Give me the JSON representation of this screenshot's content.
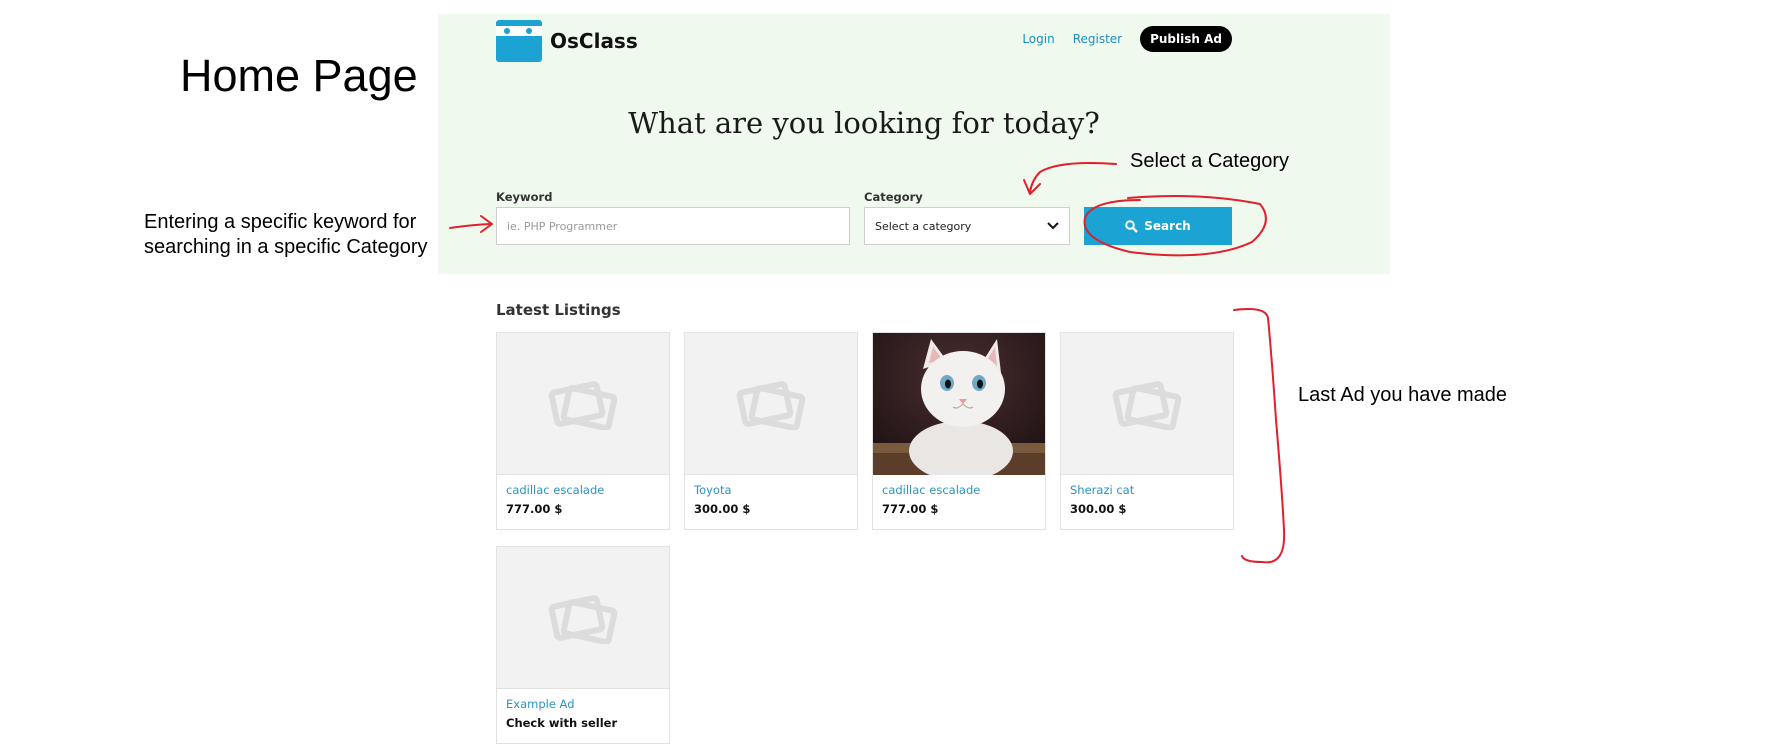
{
  "page_heading": "Home Page",
  "header": {
    "logo_text": "OsClass",
    "nav": {
      "login": "Login",
      "register": "Register",
      "publish": "Publish Ad"
    }
  },
  "hero": {
    "title": "What are you looking for today?"
  },
  "search": {
    "keyword_label": "Keyword",
    "keyword_placeholder": "ie. PHP Programmer",
    "category_label": "Category",
    "category_selected": "Select a category",
    "button_label": "Search"
  },
  "latest": {
    "title": "Latest Listings",
    "items": [
      {
        "title": "cadillac escalade",
        "price": "777.00 $",
        "image": "placeholder"
      },
      {
        "title": "Toyota",
        "price": "300.00 $",
        "image": "placeholder"
      },
      {
        "title": "cadillac escalade",
        "price": "777.00 $",
        "image": "kitten-photo"
      },
      {
        "title": "Sherazi cat",
        "price": "300.00 $",
        "image": "placeholder"
      },
      {
        "title": "Example Ad",
        "price": "Check with seller",
        "image": "placeholder"
      }
    ]
  },
  "annotations": {
    "keyword_line1": "Entering a specific keyword for",
    "keyword_line2": "searching in a specific Category",
    "category": "Select a Category",
    "last_ad": "Last Ad you have made"
  },
  "colors": {
    "accent": "#1ba3d4",
    "hero_bg": "#f0f9ee",
    "annotation_red": "#e0202a"
  }
}
